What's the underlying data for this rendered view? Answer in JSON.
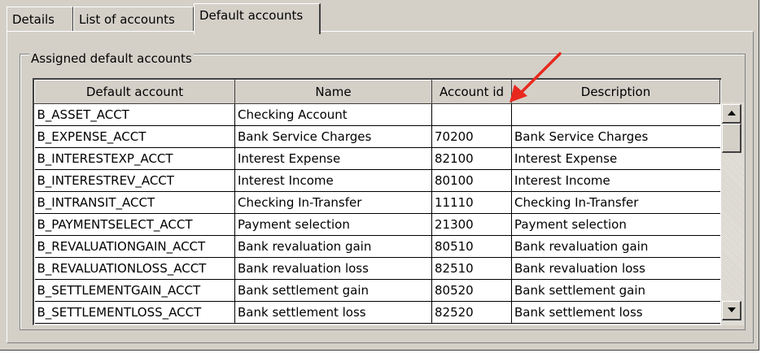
{
  "tabs": [
    {
      "label": "Details"
    },
    {
      "label": "List of accounts"
    },
    {
      "label": "Default accounts"
    }
  ],
  "group": {
    "label": "Assigned default accounts"
  },
  "table": {
    "columns": [
      "Default account",
      "Name",
      "Account id",
      "Description"
    ],
    "rows": [
      [
        "B_ASSET_ACCT",
        "Checking Account",
        "",
        ""
      ],
      [
        "B_EXPENSE_ACCT",
        "Bank Service Charges",
        "70200",
        "Bank Service Charges"
      ],
      [
        "B_INTERESTEXP_ACCT",
        "Interest Expense",
        "82100",
        "Interest Expense"
      ],
      [
        "B_INTERESTREV_ACCT",
        "Interest Income",
        "80100",
        "Interest Income"
      ],
      [
        "B_INTRANSIT_ACCT",
        "Checking In-Transfer",
        "11110",
        "Checking In-Transfer"
      ],
      [
        "B_PAYMENTSELECT_ACCT",
        "Payment selection",
        "21300",
        "Payment selection"
      ],
      [
        "B_REVALUATIONGAIN_ACCT",
        "Bank revaluation gain",
        "80510",
        "Bank revaluation gain"
      ],
      [
        "B_REVALUATIONLOSS_ACCT",
        "Bank revaluation loss",
        "82510",
        "Bank revaluation loss"
      ],
      [
        "B_SETTLEMENTGAIN_ACCT",
        "Bank settlement gain",
        "80520",
        "Bank settlement gain"
      ],
      [
        "B_SETTLEMENTLOSS_ACCT",
        "Bank settlement loss",
        "82520",
        "Bank settlement loss"
      ]
    ]
  },
  "annotation": {
    "arrow_color": "#e8281e"
  }
}
